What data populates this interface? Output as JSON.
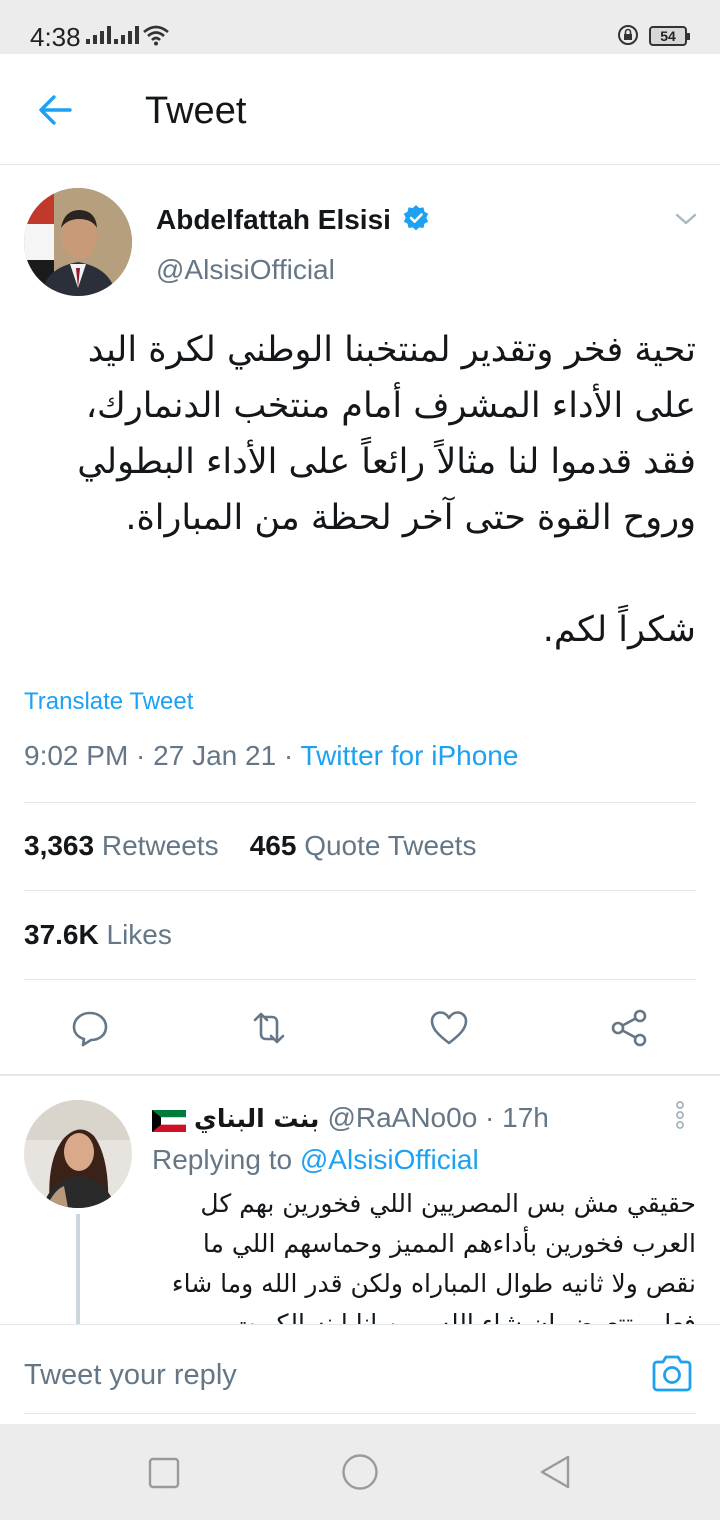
{
  "status_bar": {
    "time": "4:38",
    "battery": "54"
  },
  "header": {
    "title": "Tweet",
    "back_icon": "arrow-left-icon"
  },
  "tweet": {
    "author_name": "Abdelfattah Elsisi",
    "handle": "@AlsisiOfficial",
    "verified_icon": "verified-badge-icon",
    "text_lines": [
      "تحية فخر وتقدير لمنتخبنا الوطني لكرة اليد",
      "على الأداء المشرف أمام منتخب الدنمارك،",
      "فقد قدموا لنا مثالاً رائعاً على الأداء البطولي",
      "وروح القوة حتى آخر لحظة من المباراة.",
      "شكراً لكم."
    ],
    "translate_label": "Translate Tweet",
    "timestamp": "9:02 PM · 27 Jan 21 · ",
    "source": "Twitter for iPhone",
    "retweets_count": "3,363",
    "retweets_label": "Retweets",
    "quote_count": "465",
    "quote_label": "Quote Tweets",
    "likes_count": "37.6K",
    "likes_label": "Likes"
  },
  "actions": [
    "reply-icon",
    "retweet-icon",
    "like-icon",
    "share-icon"
  ],
  "reply": {
    "name": "بنت البناي",
    "handle_time": "@RaANo0o · 17h",
    "replying_prefix": "Replying to ",
    "replying_to": "@AlsisiOfficial",
    "text_lines": [
      "حقيقي مش بس المصريين اللي فخورين بهم كل",
      "العرب فخورين بأداءهم المميز وحماسهم اللي ما",
      "نقص ولا ثانيه طوال المباراه ولكن قدر الله وما شاء",
      "فعل وتتعوض إن شاء الله ومن انا ابنه الكويت"
    ]
  },
  "reply_box": {
    "placeholder": "Tweet your reply"
  },
  "colors": {
    "accent": "#1da1f2",
    "secondary_text": "#657786",
    "primary_text": "#14171a",
    "divider": "#e1e8ed"
  }
}
